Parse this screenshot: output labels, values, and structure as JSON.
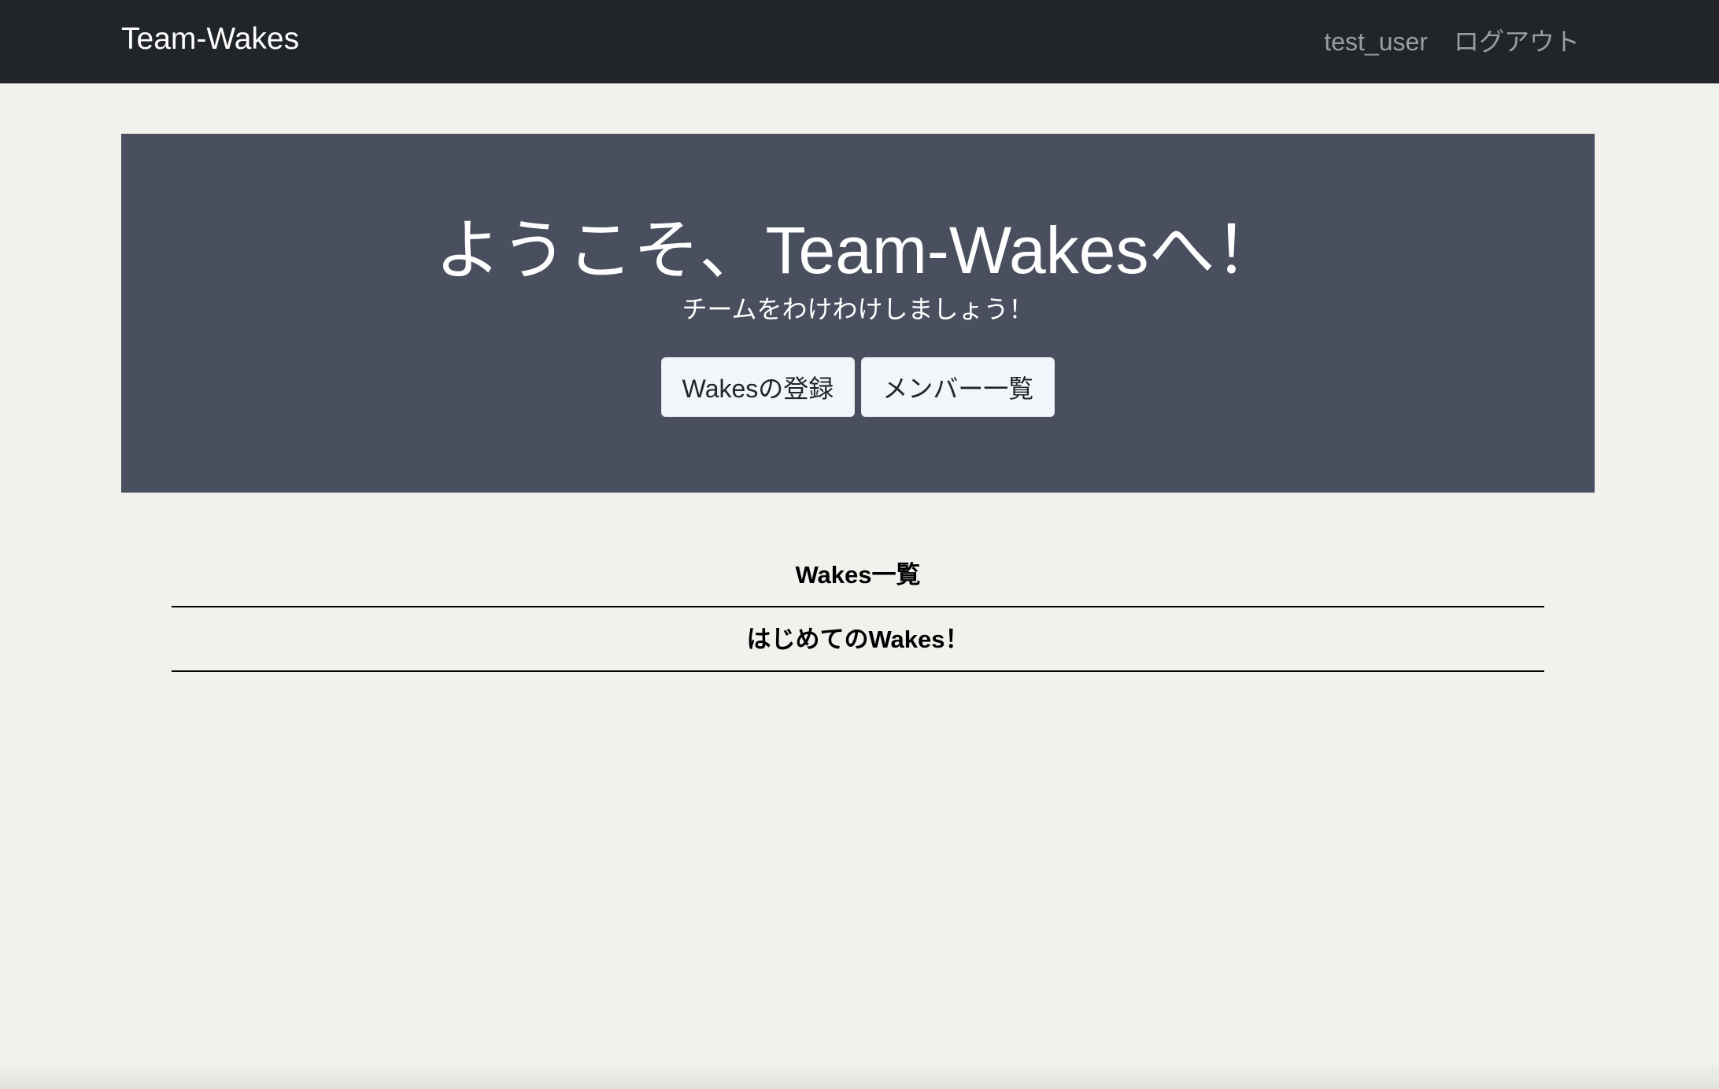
{
  "navbar": {
    "brand": "Team-Wakes",
    "user_link": "test_user",
    "logout_link": "ログアウト"
  },
  "hero": {
    "title": "ようこそ、Team-Wakesへ！",
    "subtitle": "チームをわけわけしましょう！",
    "register_button": "Wakesの登録",
    "members_button": "メンバー一覧"
  },
  "wakes_list": {
    "header": "Wakes一覧",
    "items": [
      {
        "title": "はじめてのWakes！"
      }
    ]
  },
  "colors": {
    "navbar_bg": "#212529",
    "hero_bg": "#4a4f5f",
    "page_bg": "#f1f1ee",
    "button_bg": "#f2f6fa"
  }
}
